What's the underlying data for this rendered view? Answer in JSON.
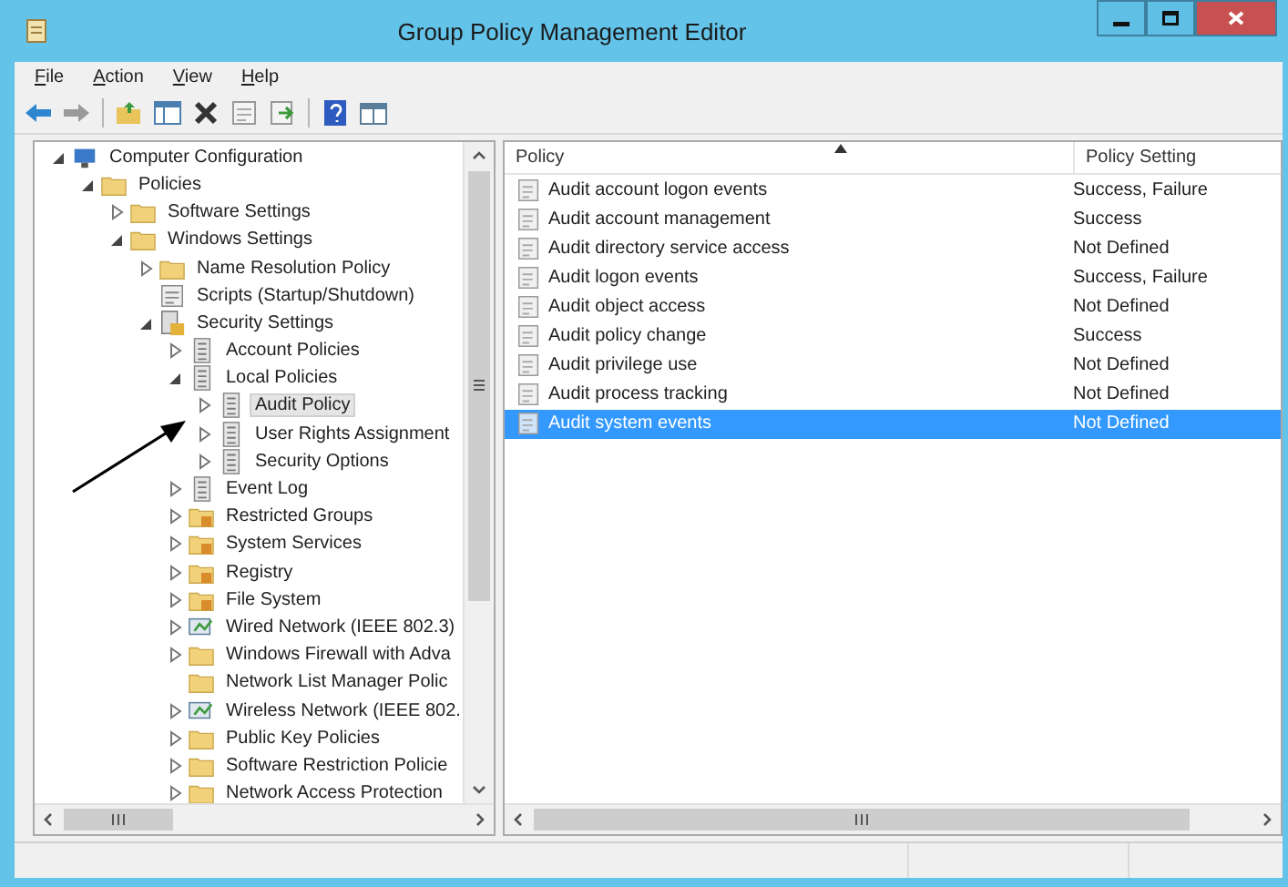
{
  "window": {
    "title": "Group Policy Management Editor"
  },
  "menu": [
    {
      "label": "File"
    },
    {
      "label": "Action"
    },
    {
      "label": "View"
    },
    {
      "label": "Help"
    }
  ],
  "tree": {
    "items": [
      {
        "label": "Computer Configuration",
        "kind": "computer",
        "expanded": true,
        "selected": false,
        "children": [
          {
            "label": "Policies",
            "kind": "folder",
            "expanded": true,
            "selected": false,
            "children": [
              {
                "label": "Software Settings",
                "kind": "folder",
                "expanded": false,
                "selected": false
              },
              {
                "label": "Windows Settings",
                "kind": "folder",
                "expanded": true,
                "selected": false,
                "children": [
                  {
                    "label": "Name Resolution Policy",
                    "kind": "folder",
                    "expanded": false,
                    "selected": false
                  },
                  {
                    "label": "Scripts (Startup/Shutdown)",
                    "kind": "script",
                    "selected": false
                  },
                  {
                    "label": "Security Settings",
                    "kind": "security",
                    "expanded": true,
                    "selected": false,
                    "children": [
                      {
                        "label": "Account Policies",
                        "kind": "policy",
                        "expanded": false,
                        "selected": false
                      },
                      {
                        "label": "Local Policies",
                        "kind": "policy",
                        "expanded": true,
                        "selected": false,
                        "children": [
                          {
                            "label": "Audit Policy",
                            "kind": "policy",
                            "expanded": false,
                            "selected": true
                          },
                          {
                            "label": "User Rights Assignment",
                            "kind": "policy",
                            "expanded": false,
                            "selected": false
                          },
                          {
                            "label": "Security Options",
                            "kind": "policy",
                            "expanded": false,
                            "selected": false
                          }
                        ]
                      },
                      {
                        "label": "Event Log",
                        "kind": "policy",
                        "expanded": false,
                        "selected": false
                      },
                      {
                        "label": "Restricted Groups",
                        "kind": "secure-folder",
                        "expanded": false,
                        "selected": false
                      },
                      {
                        "label": "System Services",
                        "kind": "secure-folder",
                        "expanded": false,
                        "selected": false
                      },
                      {
                        "label": "Registry",
                        "kind": "secure-folder",
                        "expanded": false,
                        "selected": false
                      },
                      {
                        "label": "File System",
                        "kind": "secure-folder",
                        "expanded": false,
                        "selected": false
                      },
                      {
                        "label": "Wired Network (IEEE 802.3)",
                        "kind": "network",
                        "expanded": false,
                        "selected": false
                      },
                      {
                        "label": "Windows Firewall with Adva",
                        "kind": "folder",
                        "expanded": false,
                        "selected": false
                      },
                      {
                        "label": "Network List Manager Polic",
                        "kind": "folder",
                        "selected": false
                      },
                      {
                        "label": "Wireless Network (IEEE 802.",
                        "kind": "network",
                        "expanded": false,
                        "selected": false
                      },
                      {
                        "label": "Public Key Policies",
                        "kind": "folder",
                        "expanded": false,
                        "selected": false
                      },
                      {
                        "label": "Software Restriction Policie",
                        "kind": "folder",
                        "expanded": false,
                        "selected": false
                      },
                      {
                        "label": "Network Access Protection",
                        "kind": "folder",
                        "expanded": false,
                        "selected": false
                      }
                    ]
                  }
                ]
              }
            ]
          }
        ]
      }
    ]
  },
  "list": {
    "columns": [
      {
        "label": "Policy",
        "sorted": true
      },
      {
        "label": "Policy Setting",
        "sorted": false
      }
    ],
    "rows": [
      {
        "policy": "Audit account logon events",
        "setting": "Success, Failure",
        "selected": false
      },
      {
        "policy": "Audit account management",
        "setting": "Success",
        "selected": false
      },
      {
        "policy": "Audit directory service access",
        "setting": "Not Defined",
        "selected": false
      },
      {
        "policy": "Audit logon events",
        "setting": "Success, Failure",
        "selected": false
      },
      {
        "policy": "Audit object access",
        "setting": "Not Defined",
        "selected": false
      },
      {
        "policy": "Audit policy change",
        "setting": "Success",
        "selected": false
      },
      {
        "policy": "Audit privilege use",
        "setting": "Not Defined",
        "selected": false
      },
      {
        "policy": "Audit process tracking",
        "setting": "Not Defined",
        "selected": false
      },
      {
        "policy": "Audit system events",
        "setting": "Not Defined",
        "selected": true
      }
    ]
  }
}
